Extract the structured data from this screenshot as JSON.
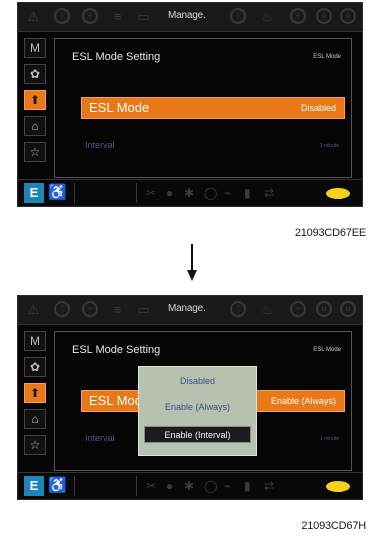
{
  "screen1": {
    "status_title": "Manage.",
    "side_tabs": [
      {
        "label": "M",
        "icon": "maintenance-icon",
        "active": false
      },
      {
        "label": "✿",
        "icon": "gear-icon",
        "active": false
      },
      {
        "label": "⬆",
        "icon": "machine-setting-icon",
        "active": true
      },
      {
        "label": "⌂",
        "icon": "monitor-icon",
        "active": false
      },
      {
        "label": "☆",
        "icon": "star-icon",
        "active": false
      }
    ],
    "title": "ESL Mode Setting",
    "tag": "ESL Mode",
    "esl_label": "ESL Mode",
    "esl_value": "Disabled",
    "interval_label": "Interval",
    "interval_value": "1 minute",
    "bottom_e": "E",
    "caption": "21093CD67EE"
  },
  "screen2": {
    "status_title": "Manage.",
    "side_tabs": [
      {
        "label": "M",
        "icon": "maintenance-icon",
        "active": false
      },
      {
        "label": "✿",
        "icon": "gear-icon",
        "active": false
      },
      {
        "label": "⬆",
        "icon": "machine-setting-icon",
        "active": true
      },
      {
        "label": "⌂",
        "icon": "monitor-icon",
        "active": false
      },
      {
        "label": "☆",
        "icon": "star-icon",
        "active": false
      }
    ],
    "title": "ESL Mode Setting",
    "tag": "ESL Mode",
    "esl_label": "ESL Mod",
    "esl_value": "Enable (Always)",
    "interval_label": "Interval",
    "interval_value": "1 minute",
    "bottom_e": "E",
    "caption": "21093CD67H",
    "popup": {
      "options": [
        "Disabled",
        "Enable (Always)",
        "Enable (Interval)"
      ],
      "selected_index": 2
    }
  },
  "colors": {
    "accent": "#e87818",
    "panel_bg": "#050505",
    "e_badge": "#1f84b8",
    "popup_bg": "#b8c0b0",
    "dim_text": "#4c5a8a",
    "lamp": "#f4d21a"
  }
}
